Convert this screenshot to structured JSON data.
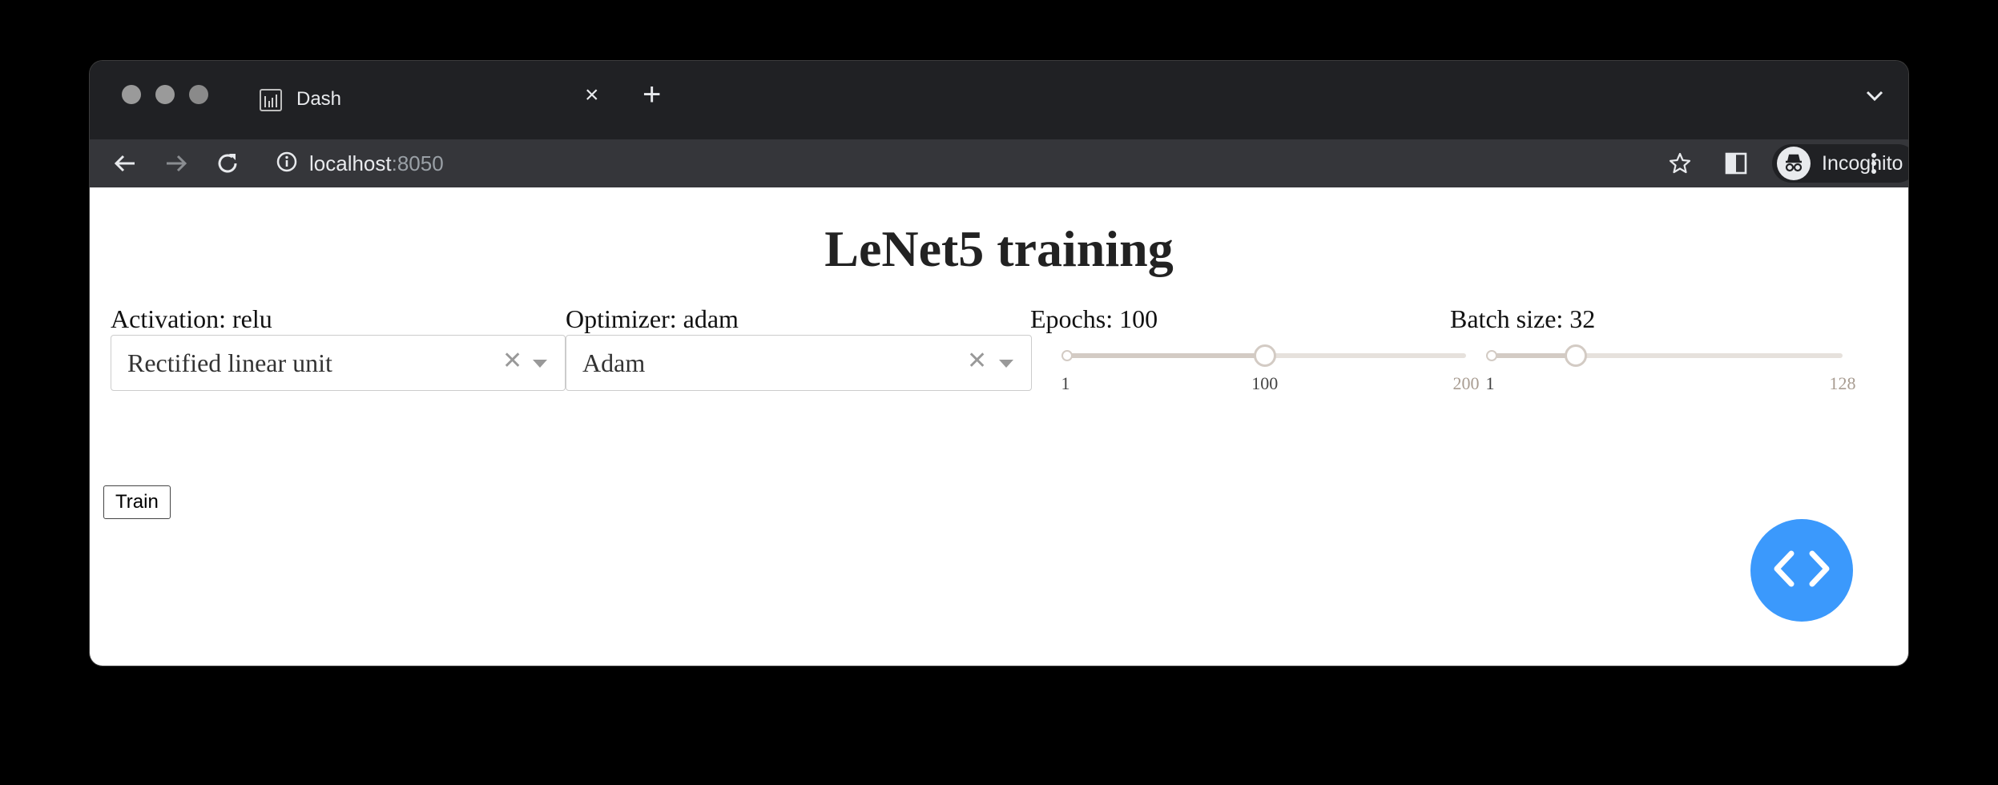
{
  "browser": {
    "tab_title": "Dash",
    "new_tab_symbol": "+",
    "close_symbol": "×",
    "address_host": "localhost",
    "address_port": ":8050",
    "incognito_label": "Incognito"
  },
  "page": {
    "title": "LeNet5 training",
    "activation": {
      "label": "Activation: relu",
      "selected": "Rectified linear unit"
    },
    "optimizer": {
      "label": "Optimizer: adam",
      "selected": "Adam"
    },
    "epochs": {
      "label": "Epochs: 100",
      "value": 100,
      "min": 1,
      "max": 200,
      "marks": [
        "1",
        "100",
        "200"
      ]
    },
    "batch_size": {
      "label": "Batch size: 32",
      "value": 32,
      "min": 1,
      "max": 128,
      "marks": [
        "1",
        "128"
      ]
    },
    "train_button": "Train"
  },
  "icons": {
    "fab": "code-brackets-icon",
    "tab_favicon": "dash-favicon-icon"
  },
  "colors": {
    "fab": "#3b99fc",
    "browser_frame": "#202124",
    "toolbar": "#35363a",
    "slider_track": "#d3cbc4"
  }
}
